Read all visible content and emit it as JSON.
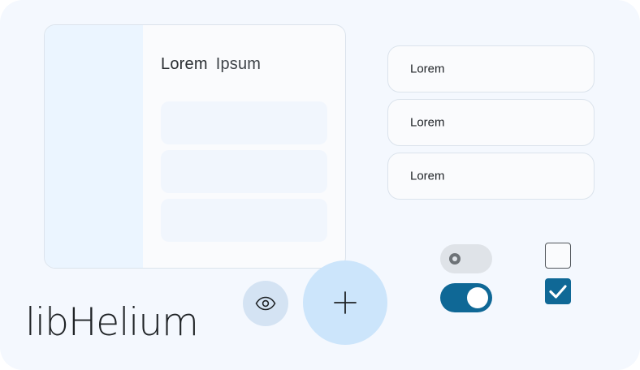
{
  "window": {
    "title_word1": "Lorem",
    "title_word2": "Ipsum",
    "rows": 3
  },
  "list": {
    "items": [
      {
        "label": "Lorem"
      },
      {
        "label": "Lorem"
      },
      {
        "label": "Lorem"
      }
    ]
  },
  "controls": {
    "switch_off": {
      "state": "off"
    },
    "switch_on": {
      "state": "on"
    },
    "checkbox_unchecked": {
      "checked": false
    },
    "checkbox_checked": {
      "checked": true
    },
    "eye_button_icon": "eye-icon",
    "fab_icon": "plus-icon"
  },
  "logo": {
    "text": "libHelium"
  },
  "colors": {
    "background": "#f4f8fe",
    "sidebar": "#ebf5ff",
    "accent": "#0f6896",
    "fab": "#cce5fb",
    "eye_button": "#d4e3f3"
  }
}
